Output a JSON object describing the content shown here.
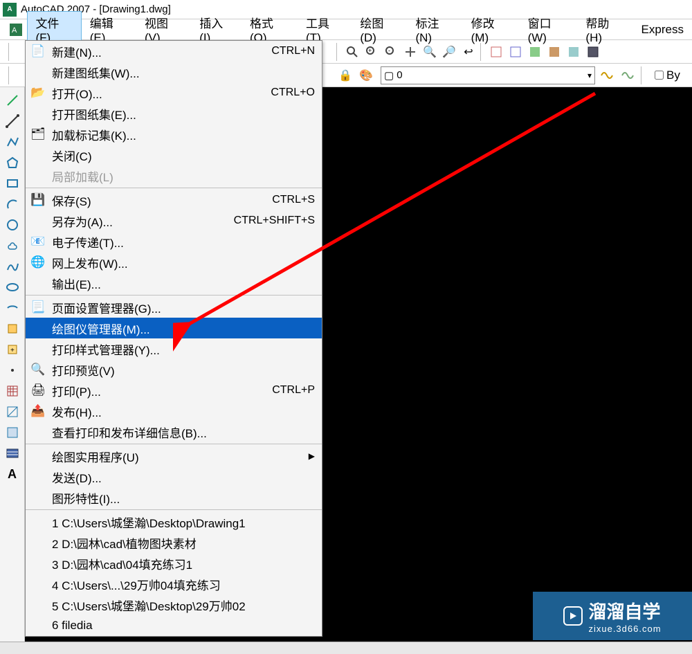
{
  "title": "AutoCAD 2007 - [Drawing1.dwg]",
  "menubar": {
    "file": "文件(F)",
    "edit": "编辑(E)",
    "view": "视图(V)",
    "insert": "插入(I)",
    "format": "格式(O)",
    "tools": "工具(T)",
    "draw": "绘图(D)",
    "annotate": "标注(N)",
    "modify": "修改(M)",
    "window": "窗口(W)",
    "help": "帮助(H)",
    "express": "Express"
  },
  "layer_combo": "0",
  "by_label": "By",
  "file_menu": {
    "new": {
      "label": "新建(N)...",
      "shortcut": "CTRL+N"
    },
    "new_sheet": {
      "label": "新建图纸集(W)..."
    },
    "open": {
      "label": "打开(O)...",
      "shortcut": "CTRL+O"
    },
    "open_sheet": {
      "label": "打开图纸集(E)..."
    },
    "load_markup": {
      "label": "加载标记集(K)..."
    },
    "close": {
      "label": "关闭(C)"
    },
    "partial": {
      "label": "局部加载(L)"
    },
    "save": {
      "label": "保存(S)",
      "shortcut": "CTRL+S"
    },
    "saveas": {
      "label": "另存为(A)...",
      "shortcut": "CTRL+SHIFT+S"
    },
    "etransmit": {
      "label": "电子传递(T)..."
    },
    "webpublish": {
      "label": "网上发布(W)..."
    },
    "export": {
      "label": "输出(E)..."
    },
    "page_setup": {
      "label": "页面设置管理器(G)..."
    },
    "plotter_mgr": {
      "label": "绘图仪管理器(M)..."
    },
    "plot_style": {
      "label": "打印样式管理器(Y)..."
    },
    "print_prev": {
      "label": "打印预览(V)"
    },
    "print": {
      "label": "打印(P)...",
      "shortcut": "CTRL+P"
    },
    "publish": {
      "label": "发布(H)..."
    },
    "view_detail": {
      "label": "查看打印和发布详细信息(B)..."
    },
    "utilities": {
      "label": "绘图实用程序(U)"
    },
    "send": {
      "label": "发送(D)..."
    },
    "props": {
      "label": "图形特性(I)..."
    },
    "recent1": {
      "label": "1 C:\\Users\\城堡瀚\\Desktop\\Drawing1"
    },
    "recent2": {
      "label": "2 D:\\园林\\cad\\植物图块素材"
    },
    "recent3": {
      "label": "3 D:\\园林\\cad\\04填充练习1"
    },
    "recent4": {
      "label": "4 C:\\Users\\...\\29万帅04填充练习"
    },
    "recent5": {
      "label": "5 C:\\Users\\城堡瀚\\Desktop\\29万帅02"
    },
    "recent6": {
      "label": "6 filedia"
    }
  },
  "watermark": {
    "brand": "溜溜自学",
    "url": "zixue.3d66.com"
  },
  "colors": {
    "highlight": "#0a60c2",
    "red": "#ff0000",
    "watermark_bg": "#1d5f91"
  }
}
